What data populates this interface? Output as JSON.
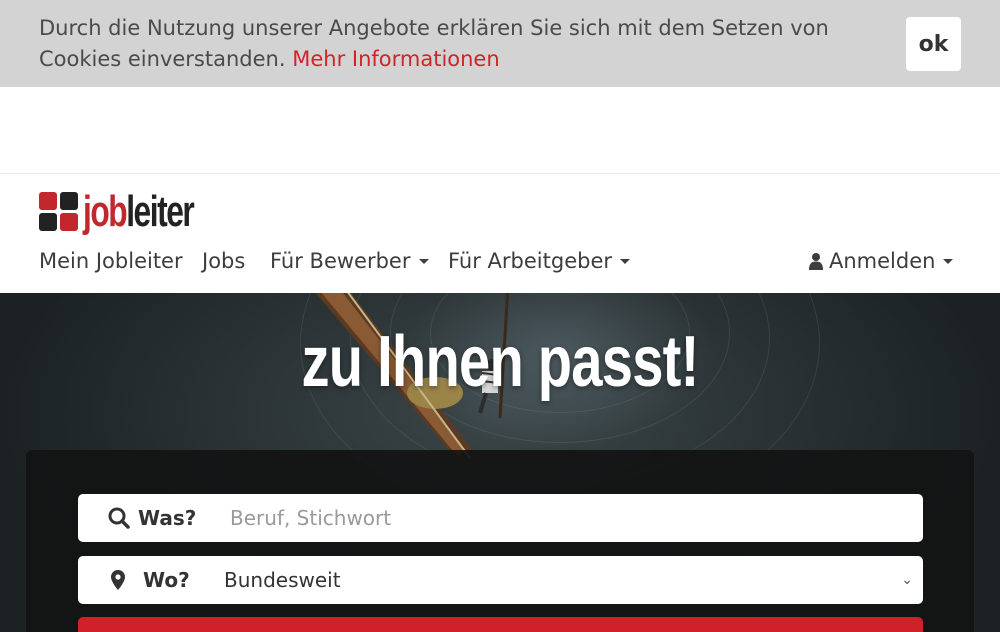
{
  "cookie_banner": {
    "text": "Durch die Nutzung unserer Angebote erklären Sie sich mit dem Setzen von Cookies einverstanden.",
    "link_label": "Mehr Informationen",
    "ok_label": "ok"
  },
  "logo": {
    "part_job": "job",
    "part_leiter": "leiter",
    "colors": [
      "#c1272d",
      "#222222",
      "#222222",
      "#c1272d"
    ]
  },
  "nav": {
    "items": [
      {
        "label": "Mein Jobleiter"
      },
      {
        "label": "Jobs"
      },
      {
        "label": "Für Bewerber"
      },
      {
        "label": "Für Arbeitgeber"
      }
    ],
    "login_label": "Anmelden"
  },
  "hero": {
    "title": "zu Ihnen passt!"
  },
  "search": {
    "what_label": "Was?",
    "what_placeholder": "Beruf, Stichwort",
    "where_label": "Wo?",
    "where_value": "Bundesweit"
  },
  "colors": {
    "brand_red": "#d0202a",
    "link_red": "#d1232a",
    "banner_bg": "#d3d3d3"
  }
}
